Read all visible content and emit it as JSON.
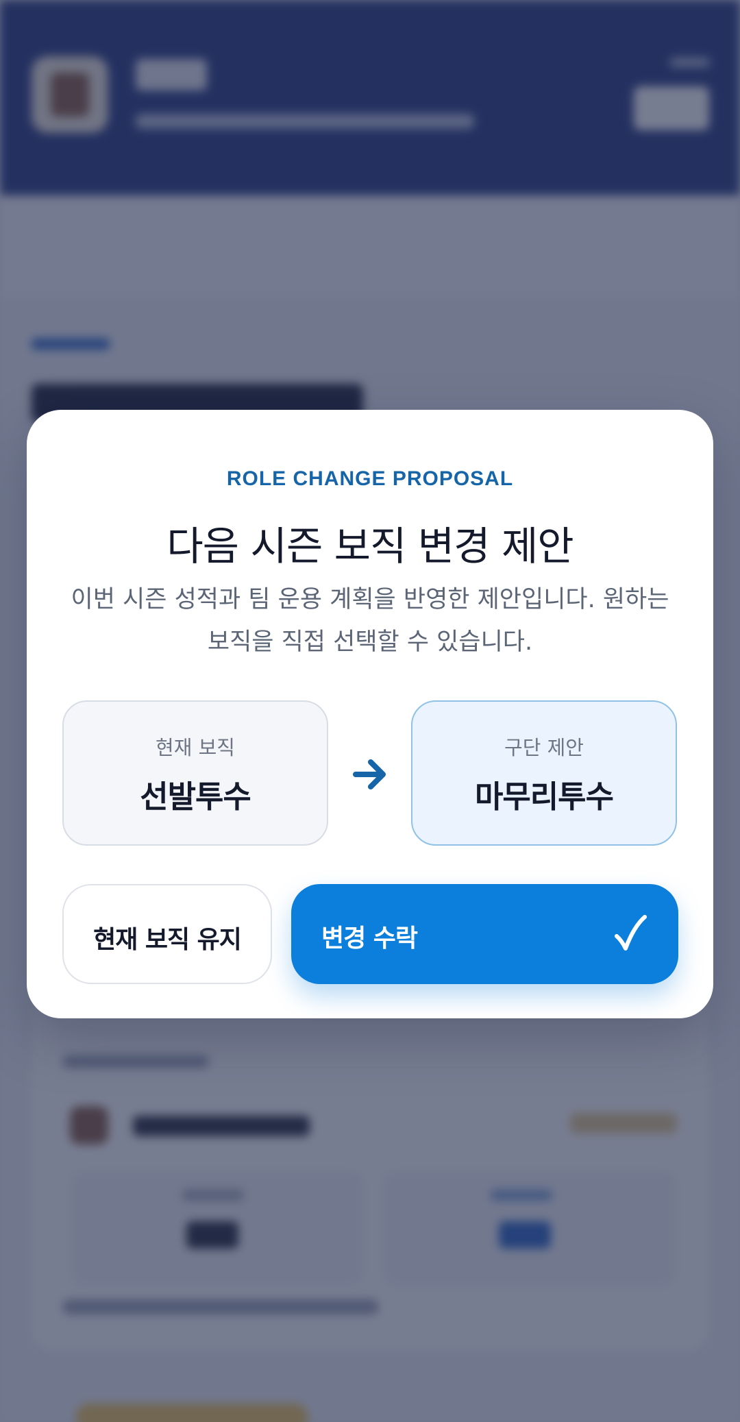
{
  "modal": {
    "eyebrow": "ROLE CHANGE PROPOSAL",
    "title": "다음 시즌 보직 변경 제안",
    "description": "이번 시즌 성적과 팀 운용 계획을 반영한 제안입니다. 원하는 보직을 직접 선택할 수 있습니다.",
    "current_role": {
      "label": "현재 보직",
      "value": "선발투수"
    },
    "proposed_role": {
      "label": "구단 제안",
      "value": "마무리투수"
    },
    "arrow_icon": "arrow-right-icon",
    "buttons": {
      "keep_label": "현재 보직 유지",
      "accept_label": "변경 수락",
      "accept_icon": "checkmark-icon"
    }
  },
  "colors": {
    "accent": "#0b7fdb",
    "eyebrow": "#1565a8",
    "header_bg": "#26367f",
    "proposed_bg": "#ebf4fe",
    "proposed_border": "#8fc2e6"
  }
}
